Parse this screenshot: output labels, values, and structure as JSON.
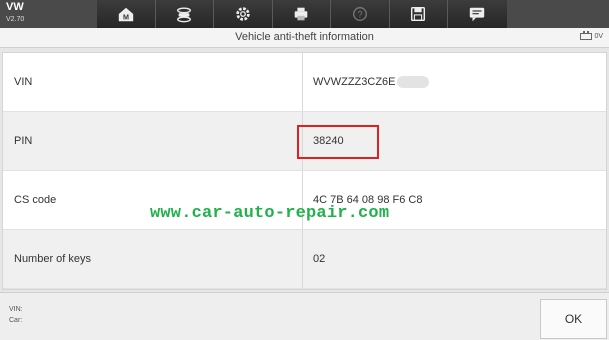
{
  "app": {
    "make": "VW",
    "version": "V2.70"
  },
  "toolbar": {
    "buttons": [
      {
        "name": "home-icon",
        "enabled": true
      },
      {
        "name": "vehicle-swap-icon",
        "enabled": true
      },
      {
        "name": "settings-icon",
        "enabled": true
      },
      {
        "name": "print-icon",
        "enabled": true
      },
      {
        "name": "help-icon",
        "enabled": false
      },
      {
        "name": "save-icon",
        "enabled": true
      },
      {
        "name": "message-icon",
        "enabled": true
      }
    ]
  },
  "header": {
    "title": "Vehicle anti-theft information",
    "battery_voltage": "0V"
  },
  "table": {
    "rows": [
      {
        "label": "VIN",
        "value": "WVWZZZ3CZ6E"
      },
      {
        "label": "PIN",
        "value": "38240"
      },
      {
        "label": "CS code",
        "value": "4C 7B 64 08 98 F6 C8"
      },
      {
        "label": "Number of keys",
        "value": "02"
      }
    ]
  },
  "watermark": "www.car-auto-repair.com",
  "footer": {
    "vin_label": "VIN:",
    "car_label": "Car:",
    "ok_label": "OK"
  },
  "colors": {
    "toolbar_bg": "#2e2e2e",
    "highlight": "#e02020",
    "watermark": "#22b14c"
  }
}
